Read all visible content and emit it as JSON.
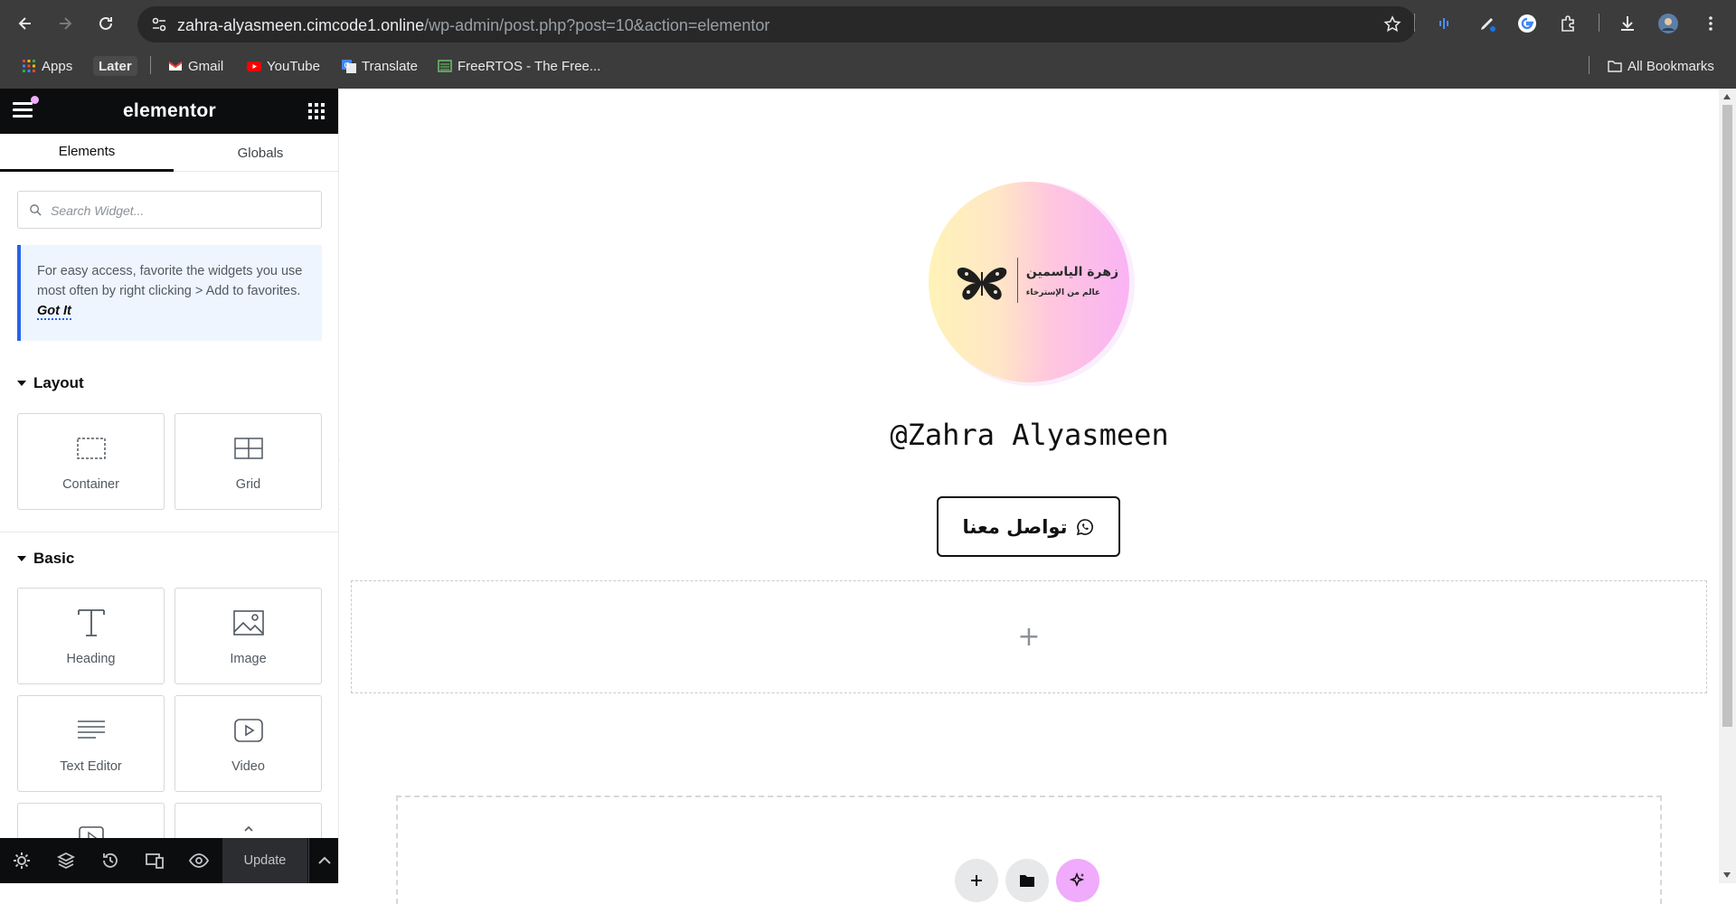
{
  "browser": {
    "url_host": "zahra-alyasmeen.cimcode1.online",
    "url_path": "/wp-admin/post.php?post=10&action=elementor",
    "bookmarks": [
      {
        "label": "Apps",
        "icon": "apps-grid-icon"
      },
      {
        "label": "Later",
        "icon": ""
      },
      {
        "label": "Gmail",
        "icon": "gmail-icon"
      },
      {
        "label": "YouTube",
        "icon": "youtube-icon"
      },
      {
        "label": "Translate",
        "icon": "translate-icon"
      },
      {
        "label": "FreeRTOS - The Free...",
        "icon": "freertos-icon"
      }
    ],
    "all_bookmarks": "All Bookmarks"
  },
  "panel": {
    "logo": "elementor",
    "tabs": [
      {
        "label": "Elements",
        "active": true
      },
      {
        "label": "Globals",
        "active": false
      }
    ],
    "search_placeholder": "Search Widget...",
    "notice": {
      "text": "For easy access, favorite the widgets you use most often by right clicking > Add to favorites.",
      "action": "Got It"
    },
    "categories": [
      {
        "title": "Layout",
        "widgets": [
          {
            "label": "Container",
            "icon": "container-icon"
          },
          {
            "label": "Grid",
            "icon": "grid-icon"
          }
        ]
      },
      {
        "title": "Basic",
        "widgets": [
          {
            "label": "Heading",
            "icon": "heading-icon"
          },
          {
            "label": "Image",
            "icon": "image-icon"
          },
          {
            "label": "Text Editor",
            "icon": "text-editor-icon"
          },
          {
            "label": "Video",
            "icon": "video-icon"
          }
        ]
      }
    ],
    "footer": {
      "update_label": "Update"
    }
  },
  "canvas": {
    "logo_text_line1": "زهرة الياسمين",
    "logo_text_line2": "عالم من الإسترخاء",
    "profile_name": "@Zahra Alyasmeen",
    "contact_button": "تواصل معنا",
    "empty_section_plus": "+",
    "accent_color": "#f0abfc"
  }
}
